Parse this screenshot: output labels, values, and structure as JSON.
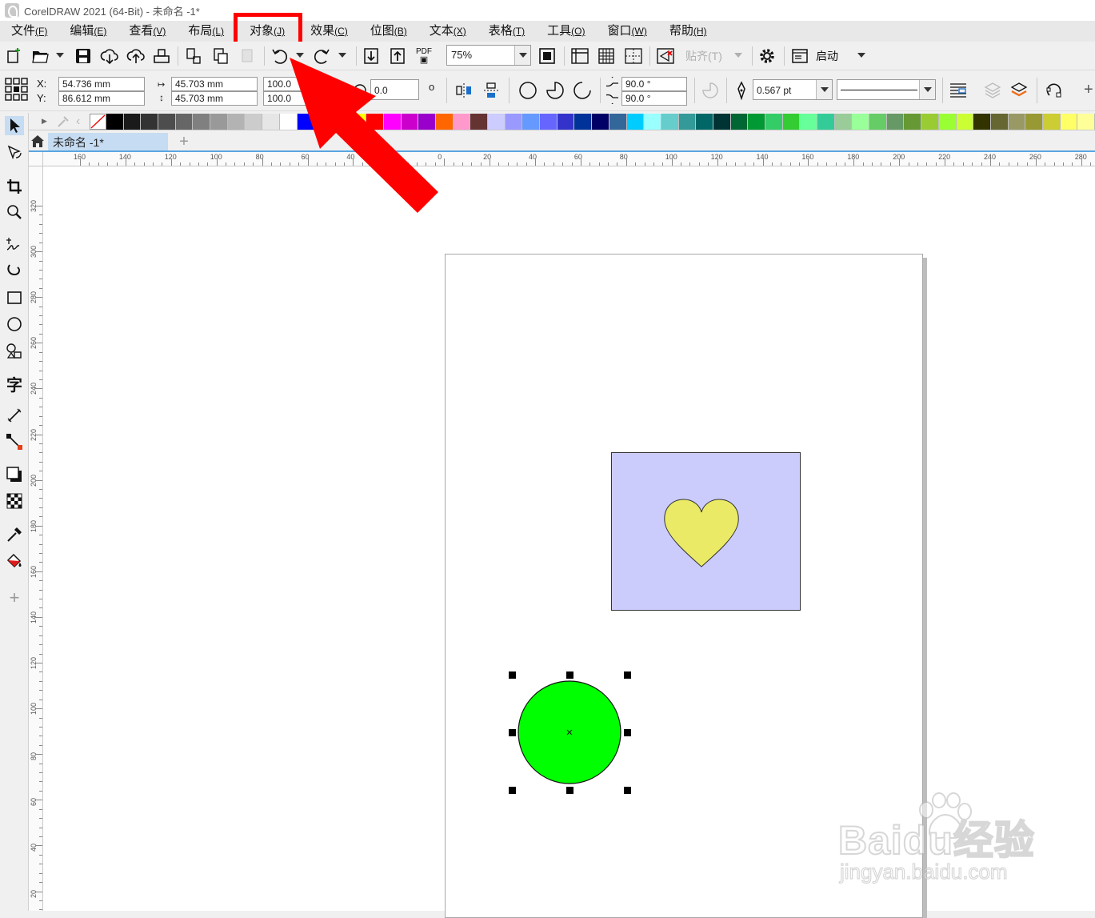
{
  "window": {
    "title": "CorelDRAW 2021 (64-Bit) - 未命名 -1*"
  },
  "menu": [
    {
      "label": "文件",
      "acc": "(F)"
    },
    {
      "label": "编辑",
      "acc": "(E)"
    },
    {
      "label": "查看",
      "acc": "(V)"
    },
    {
      "label": "布局",
      "acc": "(L)"
    },
    {
      "label": "对象",
      "acc": "(J)"
    },
    {
      "label": "效果",
      "acc": "(C)"
    },
    {
      "label": "位图",
      "acc": "(B)"
    },
    {
      "label": "文本",
      "acc": "(X)"
    },
    {
      "label": "表格",
      "acc": "(T)"
    },
    {
      "label": "工具",
      "acc": "(O)"
    },
    {
      "label": "窗口",
      "acc": "(W)"
    },
    {
      "label": "帮助",
      "acc": "(H)"
    }
  ],
  "toolbar": {
    "zoom": "75%",
    "snap_label": "贴齐(T)",
    "launch_label": "启动",
    "pdf_label": "PDF"
  },
  "properties": {
    "x_label": "X:",
    "y_label": "Y:",
    "x_value": "54.736 mm",
    "y_value": "86.612 mm",
    "width_value": "45.703 mm",
    "height_value": "45.703 mm",
    "scale_x": "100.0",
    "scale_y": "100.0",
    "rotation": "0.0",
    "start_angle": "90.0 °",
    "end_angle": "90.0 °",
    "outline_width": "0.567 pt"
  },
  "document_tab": {
    "label": "未命名 -1*"
  },
  "ruler_top_labels": [
    "160",
    "140",
    "120",
    "100",
    "80",
    "60",
    "40",
    "20",
    "0",
    "20",
    "40",
    "60",
    "80",
    "100",
    "120",
    "140",
    "160",
    "180",
    "200",
    "220",
    "240",
    "260",
    "280"
  ],
  "ruler_left_labels": [
    "320",
    "300",
    "280",
    "260",
    "240",
    "220",
    "200",
    "180",
    "160",
    "140",
    "120",
    "100",
    "80",
    "60",
    "40",
    "20"
  ],
  "palette_colors": [
    "#000000",
    "#1a1a1a",
    "#333333",
    "#4d4d4d",
    "#666666",
    "#808080",
    "#999999",
    "#b3b3b3",
    "#cccccc",
    "#e6e6e6",
    "#ffffff",
    "#0000ff",
    "#00ffff",
    "#00ff00",
    "#ffff00",
    "#ff0000",
    "#ff00ff",
    "#cc00cc",
    "#9900cc",
    "#ff6600",
    "#ff99cc",
    "#663333",
    "#ccccff",
    "#9999ff",
    "#6699ff",
    "#6666ff",
    "#3333cc",
    "#003399",
    "#000066",
    "#336699",
    "#00ccff",
    "#99ffff",
    "#66cccc",
    "#339999",
    "#006666",
    "#003333",
    "#006633",
    "#009933",
    "#33cc66",
    "#33cc33",
    "#66ff99",
    "#33cc99",
    "#99cc99",
    "#99ff99",
    "#66cc66",
    "#669966",
    "#669933",
    "#99cc33",
    "#99ff33",
    "#ccff33",
    "#333300",
    "#666633",
    "#999966",
    "#999933",
    "#cccc33",
    "#ffff66",
    "#ffff99"
  ],
  "shapes": {
    "rect_fill": "#ccccfc",
    "heart_fill": "#eaea66",
    "circle_fill": "#00ff00"
  },
  "watermark": {
    "brand": "Baidu经验",
    "url": "jingyan.baidu.com"
  }
}
